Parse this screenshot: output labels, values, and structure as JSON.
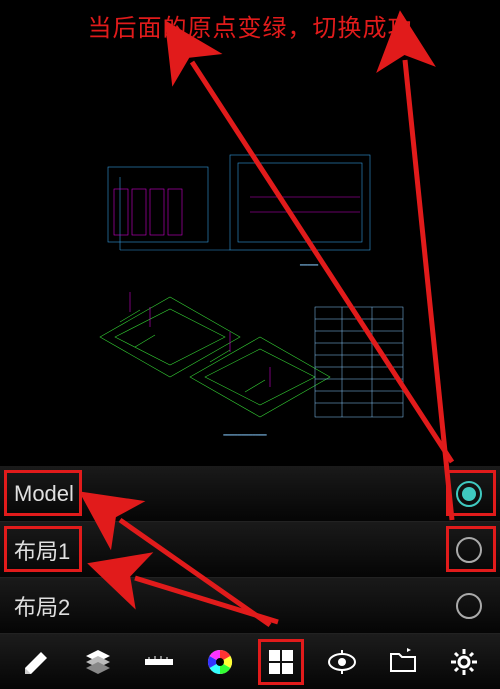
{
  "caption": "当后面的原点变绿，切换成功",
  "tabs": [
    {
      "label": "Model",
      "selected": true,
      "highlight_label": true,
      "highlight_radio": true
    },
    {
      "label": "布局1",
      "selected": false,
      "highlight_label": true,
      "highlight_radio": true
    },
    {
      "label": "布局2",
      "selected": false,
      "highlight_label": false,
      "highlight_radio": false
    }
  ],
  "toolbar": [
    {
      "name": "pencil-edit-icon",
      "highlight": false
    },
    {
      "name": "layers-icon",
      "highlight": false
    },
    {
      "name": "measure-icon",
      "highlight": false
    },
    {
      "name": "color-wheel-icon",
      "highlight": false
    },
    {
      "name": "layout-tabs-icon",
      "highlight": true
    },
    {
      "name": "view-icon",
      "highlight": false
    },
    {
      "name": "folder-icon",
      "highlight": false
    },
    {
      "name": "gear-icon",
      "highlight": false
    }
  ],
  "colors": {
    "annotation": "#e11b1b",
    "radio_active": "#3fc9c0"
  }
}
